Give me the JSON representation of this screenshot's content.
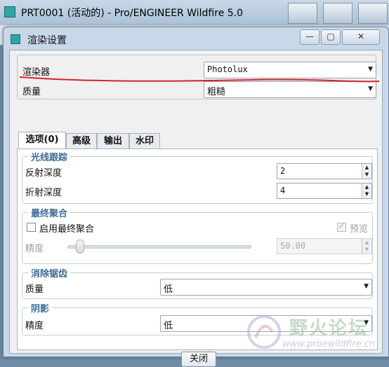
{
  "app": {
    "title": "PRT0001 (活动的) - Pro/ENGINEER Wildfire 5.0"
  },
  "dialog": {
    "title": "渲染设置",
    "close_glyph": "✕",
    "min_glyph": "—",
    "max_glyph": "▢"
  },
  "renderer": {
    "label": "渲染器",
    "value": "Photolux"
  },
  "quality": {
    "label": "质量",
    "value": "粗糙"
  },
  "tabs": [
    {
      "label": "选项(0)",
      "active": true
    },
    {
      "label": "高级",
      "active": false
    },
    {
      "label": "输出",
      "active": false
    },
    {
      "label": "水印",
      "active": false
    }
  ],
  "ray_tracing": {
    "title": "光线跟踪",
    "reflection": {
      "label": "反射深度",
      "value": "2"
    },
    "refraction": {
      "label": "折射深度",
      "value": "4"
    }
  },
  "final_gather": {
    "title": "最终聚合",
    "enable_label": "启用最终聚合",
    "enable_checked": false,
    "preview_label": "预览",
    "preview_checked": true,
    "precision_label": "精度",
    "precision_value": "50.00"
  },
  "antialias": {
    "title": "消除锯齿",
    "quality_label": "质量",
    "quality_value": "低"
  },
  "shadow": {
    "title": "阴影",
    "precision_label": "精度",
    "precision_value": "低"
  },
  "close_button": "关闭",
  "watermark": {
    "text": "野火论坛",
    "url": "www.proewildfire.cn"
  },
  "colors": {
    "annotation_red": "#d8202a",
    "group_title": "#3d6c9a"
  }
}
